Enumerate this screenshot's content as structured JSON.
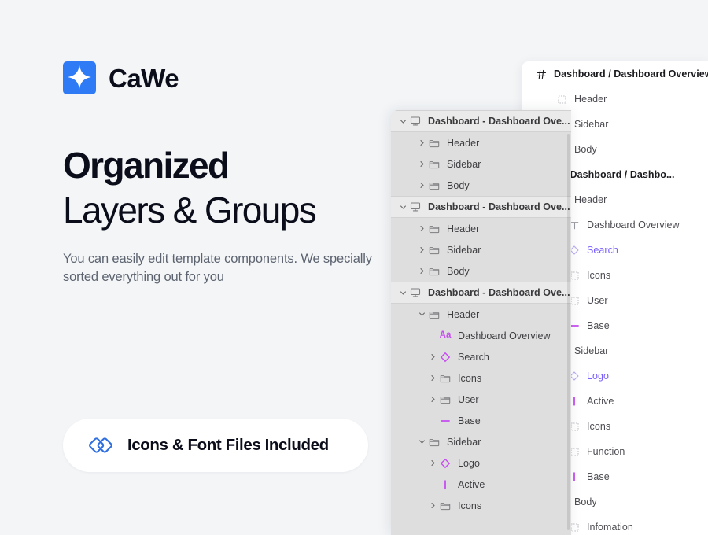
{
  "brand": {
    "name": "CaWe",
    "logo_icon": "sparkle-icon",
    "logo_color": "#2f7bf6"
  },
  "hero": {
    "headline_line1": "Organized",
    "headline_line2": "Layers & Groups",
    "subcopy": "You can easily edit template components. We specially sorted everything out for you"
  },
  "pill": {
    "icon": "overlapping-diamonds-icon",
    "icon_color": "#2f6fe0",
    "label": "Icons & Font Files Included"
  },
  "colors": {
    "page_background": "#f3f5f7",
    "mid_panel_background": "#dededf",
    "mid_panel_section_background": "#eaeaeb",
    "right_panel_background": "#ffffff",
    "component_purple": "#7b61ff",
    "figma_magenta": "#c64df0",
    "text_dark": "#0b0d1a",
    "text_muted": "#5d6470"
  },
  "mid_panel": {
    "name": "layers-panel-gray",
    "rows": [
      {
        "label": "Dashboard - Dashboard Ove...",
        "icon": "frame-screen-icon",
        "twisty": "down",
        "depth": "section"
      },
      {
        "label": "Header",
        "icon": "folder-icon",
        "twisty": "right",
        "depth": "d2"
      },
      {
        "label": "Sidebar",
        "icon": "folder-icon",
        "twisty": "right",
        "depth": "d2"
      },
      {
        "label": "Body",
        "icon": "folder-icon",
        "twisty": "right",
        "depth": "d2"
      },
      {
        "label": "Dashboard - Dashboard Ove...",
        "icon": "frame-screen-icon",
        "twisty": "down",
        "depth": "section"
      },
      {
        "label": "Header",
        "icon": "folder-icon",
        "twisty": "right",
        "depth": "d2"
      },
      {
        "label": "Sidebar",
        "icon": "folder-icon",
        "twisty": "right",
        "depth": "d2"
      },
      {
        "label": "Body",
        "icon": "folder-icon",
        "twisty": "right",
        "depth": "d2"
      },
      {
        "label": "Dashboard - Dashboard Ove...",
        "icon": "frame-screen-icon",
        "twisty": "down",
        "depth": "section"
      },
      {
        "label": "Header",
        "icon": "folder-icon",
        "twisty": "down",
        "depth": "d2"
      },
      {
        "label": "Dashboard Overview",
        "icon": "text-aa-icon",
        "twisty": "none",
        "depth": "d3"
      },
      {
        "label": "Search",
        "icon": "component-diamond-icon",
        "twisty": "right",
        "depth": "d3"
      },
      {
        "label": "Icons",
        "icon": "folder-icon",
        "twisty": "right",
        "depth": "d3"
      },
      {
        "label": "User",
        "icon": "folder-icon",
        "twisty": "right",
        "depth": "d3"
      },
      {
        "label": "Base",
        "icon": "line-horizontal-icon",
        "twisty": "none",
        "depth": "d3"
      },
      {
        "label": "Sidebar",
        "icon": "folder-icon",
        "twisty": "down",
        "depth": "d2"
      },
      {
        "label": "Logo",
        "icon": "component-diamond-icon",
        "twisty": "right",
        "depth": "d3"
      },
      {
        "label": "Active",
        "icon": "line-vertical-icon",
        "twisty": "none",
        "depth": "d3"
      },
      {
        "label": "Icons",
        "icon": "folder-icon",
        "twisty": "right",
        "depth": "d3"
      }
    ]
  },
  "right_panel": {
    "name": "layers-panel-white",
    "rows": [
      {
        "label": "Dashboard / Dashboard Overview...",
        "icon": "hash-icon",
        "depth": "section"
      },
      {
        "label": "Header",
        "icon": "frame-dotted-icon",
        "depth": "indent"
      },
      {
        "label": "Sidebar",
        "icon": "frame-dotted-icon",
        "depth": "indent"
      },
      {
        "label": "Body",
        "icon": "frame-dotted-icon",
        "depth": "indent"
      },
      {
        "label": "board / Dashboard / Dashbo...",
        "icon": "none",
        "depth": "section"
      },
      {
        "label": "Header",
        "icon": "frame-dotted-icon",
        "depth": "indent"
      },
      {
        "label": "Dashboard Overview",
        "icon": "text-t-icon",
        "depth": "indent2"
      },
      {
        "label": "Search",
        "icon": "component-diamond-outline-icon",
        "depth": "indent2",
        "component": true
      },
      {
        "label": "Icons",
        "icon": "frame-dotted-icon",
        "depth": "indent2"
      },
      {
        "label": "User",
        "icon": "frame-dotted-icon",
        "depth": "indent2"
      },
      {
        "label": "Base",
        "icon": "line-horizontal-icon",
        "depth": "indent2"
      },
      {
        "label": "Sidebar",
        "icon": "frame-dotted-icon",
        "depth": "indent"
      },
      {
        "label": "Logo",
        "icon": "component-diamond-outline-icon",
        "depth": "indent2",
        "component": true
      },
      {
        "label": "Active",
        "icon": "line-vertical-icon",
        "depth": "indent2"
      },
      {
        "label": "Icons",
        "icon": "frame-dotted-icon",
        "depth": "indent2"
      },
      {
        "label": "Function",
        "icon": "frame-dotted-icon",
        "depth": "indent2"
      },
      {
        "label": "Base",
        "icon": "line-vertical-icon",
        "depth": "indent2"
      },
      {
        "label": "Body",
        "icon": "frame-dotted-icon",
        "depth": "indent"
      },
      {
        "label": "Infomation",
        "icon": "frame-dotted-icon",
        "depth": "indent2"
      }
    ]
  }
}
